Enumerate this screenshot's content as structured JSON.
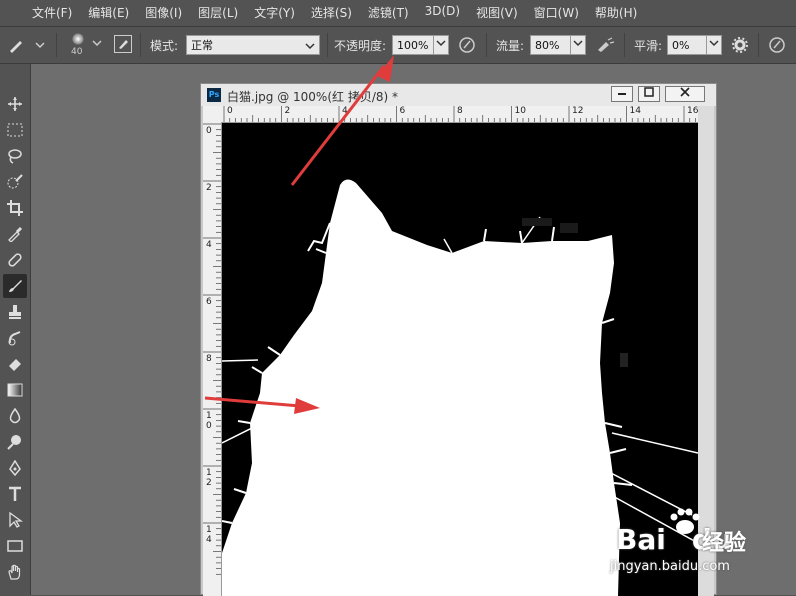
{
  "menu": [
    "文件(F)",
    "编辑(E)",
    "图像(I)",
    "图层(L)",
    "文字(Y)",
    "选择(S)",
    "滤镜(T)",
    "3D(D)",
    "视图(V)",
    "窗口(W)",
    "帮助(H)"
  ],
  "options": {
    "brush_size": "40",
    "mode_label": "模式:",
    "mode_value": "正常",
    "opacity_label": "不透明度:",
    "opacity_value": "100%",
    "flow_label": "流量:",
    "flow_value": "80%",
    "smooth_label": "平滑:",
    "smooth_value": "0%"
  },
  "document": {
    "title": "白猫.jpg @ 100%(红 拷贝/8) *",
    "ps_badge": "Ps",
    "hruler": [
      "0",
      "2",
      "4",
      "6",
      "8",
      "10",
      "12",
      "14",
      "16"
    ],
    "vruler": [
      "0",
      "2",
      "4",
      "6",
      "8",
      "10",
      "12",
      "14"
    ]
  },
  "watermark": {
    "brand": "Bai",
    "brand2": "du",
    "jingyan": "经验",
    "url": "jingyan.baidu.com"
  },
  "colors": {
    "annotation_arrow": "#e03c3c",
    "canvas_bg": "#000000",
    "cat": "#ffffff"
  }
}
